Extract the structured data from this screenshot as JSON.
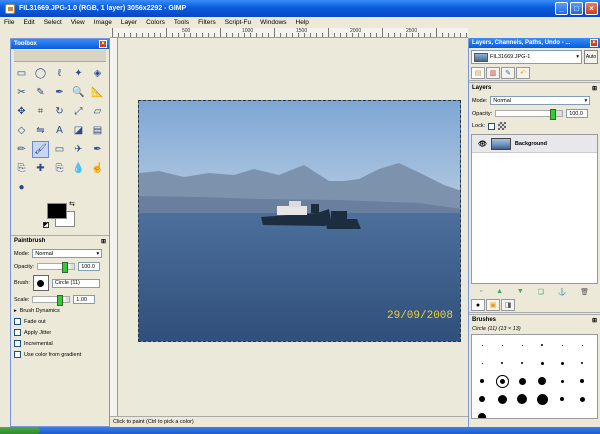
{
  "window": {
    "title": "FIL31669.JPG-1.0 (RGB, 1 layer) 3056x2292 - GIMP",
    "buttons": {
      "minimize": "_",
      "maximize": "□",
      "close": "×"
    }
  },
  "menu": [
    "File",
    "Edit",
    "Select",
    "View",
    "Image",
    "Layer",
    "Colors",
    "Tools",
    "Filters",
    "Script-Fu",
    "Windows",
    "Help"
  ],
  "ruler": {
    "labels": [
      "500",
      "1000",
      "1500",
      "2000",
      "2500"
    ]
  },
  "photo": {
    "date_stamp": "29/09/2008"
  },
  "status": {
    "text": "Click to paint (Ctrl to pick a color)"
  },
  "toolbox": {
    "title": "Toolbox",
    "close": "×",
    "tools": [
      "rect-select-icon",
      "ellipse-select-icon",
      "lasso-icon",
      "fuzzy-select-icon",
      "color-select-icon",
      "scissors-icon",
      "paths-icon",
      "color-picker-icon",
      "zoom-icon",
      "measure-icon",
      "move-icon",
      "crop-icon",
      "rotate-icon",
      "scale-icon",
      "shear-icon",
      "perspective-icon",
      "flip-icon",
      "text-icon",
      "bucket-fill-icon",
      "blend-icon",
      "pencil-icon",
      "paintbrush-icon",
      "eraser-icon",
      "airbrush-icon",
      "ink-icon",
      "clone-icon",
      "heal-icon",
      "perspective-clone-icon",
      "blur-icon",
      "smudge-icon",
      "dodge-icon"
    ],
    "tool_glyphs": [
      "▭",
      "◯",
      "ℓ",
      "✦",
      "◈",
      "✂",
      "✎",
      "✒",
      "🔍",
      "📐",
      "✥",
      "⌗",
      "↻",
      "⤢",
      "▱",
      "◇",
      "⇋",
      "A",
      "◪",
      "▤",
      "✏",
      "🖌",
      "▭",
      "✈",
      "✒",
      "⎘",
      "✚",
      "⎘",
      "💧",
      "☝",
      "●"
    ]
  },
  "tool_options": {
    "title": "Paintbrush",
    "mode_label": "Mode:",
    "mode_value": "Normal",
    "opacity_label": "Opacity:",
    "opacity_value": "100.0",
    "brush_label": "Brush:",
    "brush_value": "Circle (11)",
    "scale_label": "Scale:",
    "scale_value": "1.00",
    "brush_dynamics": "Brush Dynamics",
    "checkboxes": [
      "Fade out",
      "Apply Jitter",
      "Incremental",
      "Use color from gradient"
    ]
  },
  "dock": {
    "title": "Layers, Channels, Paths, Undo - ...",
    "image_selector": "FIL31669.JPG-1",
    "auto_label": "Auto",
    "layers_title": "Layers",
    "mode_label": "Mode:",
    "mode_value": "Normal",
    "opacity_label": "Opacity:",
    "opacity_value": "100.0",
    "lock_label": "Lock:",
    "layer_name": "Background",
    "brushes_title": "Brushes",
    "brush_info": "Circle (11) (13 × 13)"
  },
  "colors": {
    "foreground": "#000000",
    "background": "#ffffff"
  }
}
